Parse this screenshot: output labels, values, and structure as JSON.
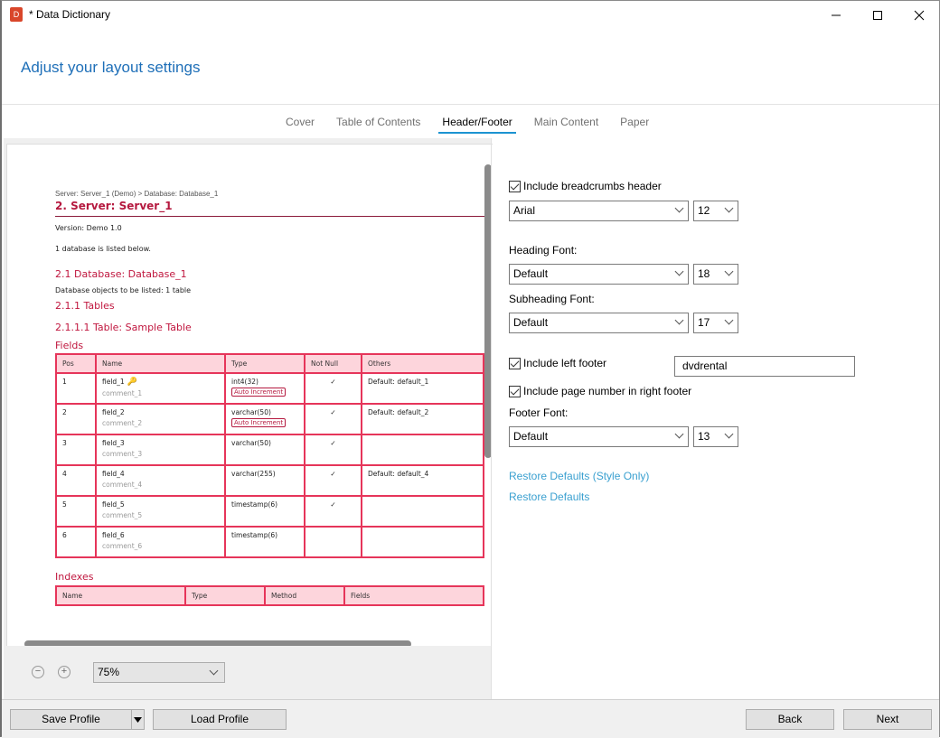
{
  "window": {
    "title": "* Data Dictionary",
    "app_icon_letter": "D",
    "minimize_glyph": "—",
    "maximize_glyph": "☐",
    "close_glyph": "✕"
  },
  "page_heading": "Adjust your layout settings",
  "tabs": [
    {
      "label": "Cover",
      "active": false
    },
    {
      "label": "Table of Contents",
      "active": false
    },
    {
      "label": "Header/Footer",
      "active": true
    },
    {
      "label": "Main Content",
      "active": false
    },
    {
      "label": "Paper",
      "active": false
    }
  ],
  "preview": {
    "breadcrumb": "Server: Server_1 (Demo)  >  Database: Database_1",
    "server_heading": "2. Server: Server_1",
    "version": "Version: Demo 1.0",
    "db_listed": "1 database is listed below.",
    "db_heading": "2.1 Database: Database_1",
    "db_objects": "Database objects to be listed: 1 table",
    "tables_heading": "2.1.1 Tables",
    "table_heading": "2.1.1.1 Table: Sample Table",
    "fields_heading": "Fields",
    "fields_columns": [
      "Pos",
      "Name",
      "Type",
      "Not Null",
      "Others"
    ],
    "fields_rows": [
      {
        "pos": "1",
        "name": "field_1",
        "comment": "comment_1",
        "type": "int4(32)",
        "badge": "Auto Increment",
        "key": true,
        "not_null": "✓",
        "others": "Default: default_1"
      },
      {
        "pos": "2",
        "name": "field_2",
        "comment": "comment_2",
        "type": "varchar(50)",
        "badge": "Auto Increment",
        "key": false,
        "not_null": "✓",
        "others": "Default: default_2"
      },
      {
        "pos": "3",
        "name": "field_3",
        "comment": "comment_3",
        "type": "varchar(50)",
        "badge": "",
        "key": false,
        "not_null": "✓",
        "others": ""
      },
      {
        "pos": "4",
        "name": "field_4",
        "comment": "comment_4",
        "type": "varchar(255)",
        "badge": "",
        "key": false,
        "not_null": "✓",
        "others": "Default: default_4"
      },
      {
        "pos": "5",
        "name": "field_5",
        "comment": "comment_5",
        "type": "timestamp(6)",
        "badge": "",
        "key": false,
        "not_null": "✓",
        "others": ""
      },
      {
        "pos": "6",
        "name": "field_6",
        "comment": "comment_6",
        "type": "timestamp(6)",
        "badge": "",
        "key": false,
        "not_null": "",
        "others": ""
      }
    ],
    "indexes_heading": "Indexes",
    "indexes_columns": [
      "Name",
      "Type",
      "Method",
      "Fields"
    ]
  },
  "zoom": {
    "value": "75%",
    "zoom_out_glyph": "−",
    "zoom_in_glyph": "+"
  },
  "settings": {
    "breadcrumbs_header": {
      "label": "Include breadcrumbs header",
      "checked": true,
      "font": "Arial",
      "size": "12"
    },
    "heading_font": {
      "label": "Heading Font:",
      "font": "Default",
      "size": "18"
    },
    "subheading_font": {
      "label": "Subheading Font:",
      "font": "Default",
      "size": "17"
    },
    "left_footer": {
      "label": "Include left footer",
      "checked": true,
      "value": "dvdrental"
    },
    "page_number": {
      "label": "Include page number in right footer",
      "checked": true
    },
    "footer_font": {
      "label": "Footer Font:",
      "font": "Default",
      "size": "13"
    },
    "restore_style_only": "Restore Defaults (Style Only)",
    "restore_defaults": "Restore Defaults"
  },
  "footer": {
    "save_profile": "Save Profile",
    "load_profile": "Load Profile",
    "back": "Back",
    "next": "Next"
  },
  "colors": {
    "accent": "#1c93d1",
    "heading_blue": "#1e6fb8",
    "doc_red": "#c0163e",
    "table_border": "#e6355a",
    "table_header_bg": "#fdd5dc",
    "link": "#3aa0d0"
  }
}
